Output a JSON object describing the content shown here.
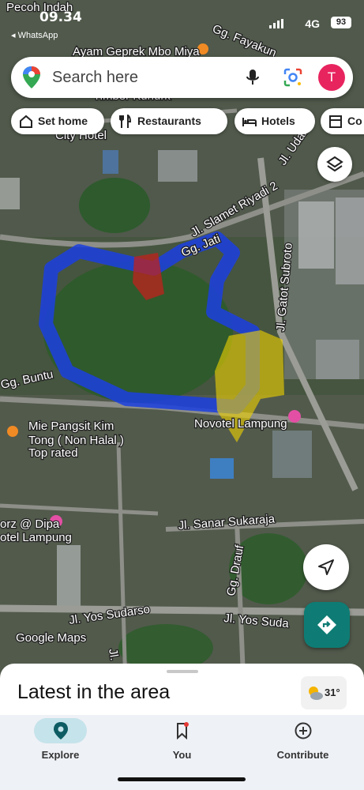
{
  "status_bar": {
    "time": "09.34",
    "back_app": "◂ WhatsApp",
    "network": "4G",
    "battery": "93"
  },
  "search": {
    "placeholder": "Search here",
    "avatar_letter": "T"
  },
  "chips": [
    {
      "label": "Set home",
      "icon": "home-icon"
    },
    {
      "label": "Restaurants",
      "icon": "fork-knife-icon"
    },
    {
      "label": "Hotels",
      "icon": "bed-icon"
    },
    {
      "label": "Co",
      "icon": "store-icon"
    }
  ],
  "map": {
    "labels": {
      "top_left": "Pecoh Indah",
      "fayakun": "Gg. Fayakun",
      "ayam": "Ayam Geprek Mbo Miya",
      "timber": "Timber Kunurk",
      "city_hotel": "City Hotel",
      "slamet": "Jl. Slamet Riyadi 2",
      "udan": "Jl. Udan",
      "jati": "Gg. Jati",
      "gatot": "Jl. Gatot Subroto",
      "buntu": "Gg. Buntu",
      "mie1": "Mie Pangsit Kim",
      "mie2": "Tong ( Non Halal )",
      "top_rated": "Top rated",
      "novotel": "Novotel Lampung",
      "dipa1": "orz @ Dipa",
      "dipa2": "otel Lampung",
      "sanar": "Jl. Sanar Sukaraja",
      "drauf": "Gg. Drauf",
      "yos1": "Jl. Yos Sudarso",
      "yos2": "Jl. Yos Suda",
      "google_maps": "Google Maps",
      "jl_vertical": "Jl."
    },
    "colors": {
      "outline": "#1b3fe0",
      "marker_red": "#c0221c",
      "highlight_yellow": "#f2d400"
    }
  },
  "sheet": {
    "title": "Latest in the area",
    "weather_temp": "31°",
    "weather_icon": "sun-cloud-icon"
  },
  "bottom_nav": [
    {
      "label": "Explore",
      "icon": "explore-pin-icon",
      "active": true
    },
    {
      "label": "You",
      "icon": "bookmark-icon",
      "active": false
    },
    {
      "label": "Contribute",
      "icon": "add-circle-icon",
      "active": false
    }
  ]
}
